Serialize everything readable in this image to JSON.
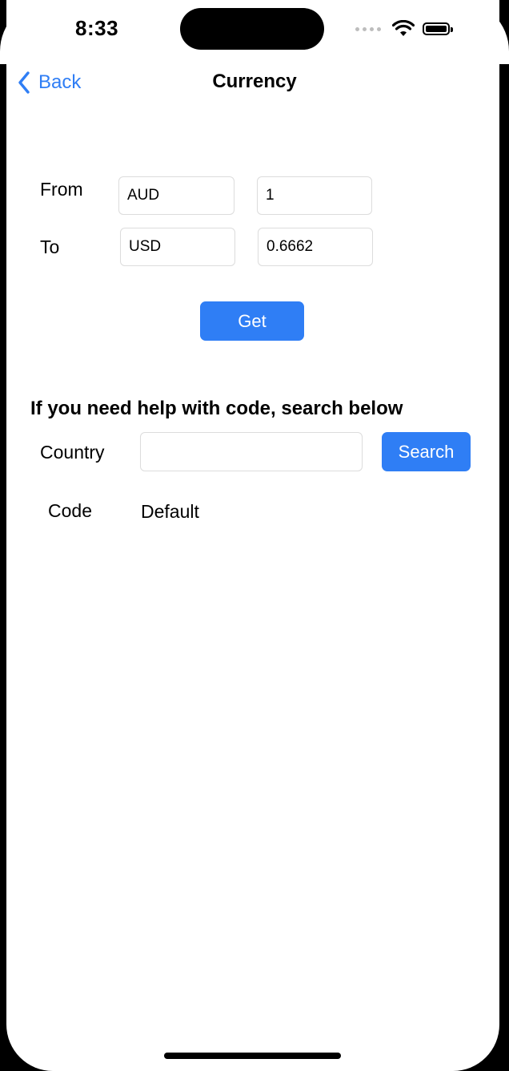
{
  "status_bar": {
    "time": "8:33"
  },
  "nav": {
    "back_label": "Back",
    "title": "Currency"
  },
  "converter": {
    "from_label": "From",
    "from_code": "AUD",
    "from_amount": "1",
    "to_label": "To",
    "to_code": "USD",
    "to_amount": "0.6662",
    "get_label": "Get"
  },
  "help": {
    "heading": "If you need help with code, search below",
    "country_label": "Country",
    "country_value": "",
    "search_label": "Search",
    "code_label": "Code",
    "code_value": "Default"
  },
  "colors": {
    "accent": "#2F7EF5"
  }
}
